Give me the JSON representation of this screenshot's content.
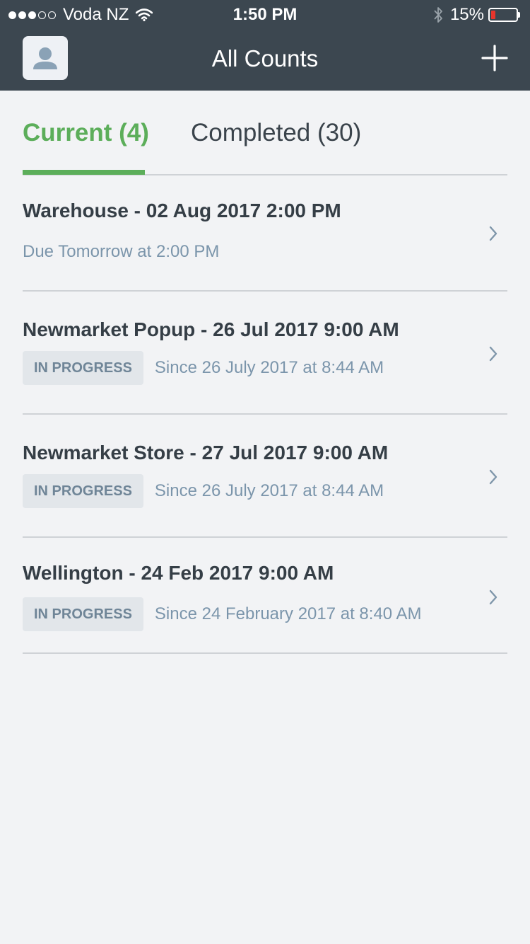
{
  "status_bar": {
    "carrier": "Voda NZ",
    "time": "1:50 PM",
    "battery_percent": "15%",
    "battery_level": 0.15,
    "signal_bars_filled": 3,
    "signal_bars_total": 5,
    "wifi_icon": "wifi-icon",
    "bluetooth_icon": "bluetooth-icon"
  },
  "header": {
    "title": "All Counts",
    "left_icon": "user-avatar-icon",
    "right_icon": "plus-icon"
  },
  "tabs": [
    {
      "label": "Current (4)",
      "active": true
    },
    {
      "label": "Completed (30)",
      "active": false
    }
  ],
  "counts": [
    {
      "title": "Warehouse - 02 Aug 2017 2:00 PM",
      "badge": "",
      "subtitle": "Due Tomorrow at 2:00 PM"
    },
    {
      "title": "Newmarket Popup - 26 Jul 2017 9:00 AM",
      "badge": "IN PROGRESS",
      "subtitle": "Since 26 July 2017 at 8:44 AM"
    },
    {
      "title": "Newmarket Store - 27 Jul 2017 9:00 AM",
      "badge": "IN PROGRESS",
      "subtitle": "Since 26 July 2017 at 8:44 AM"
    },
    {
      "title": "Wellington - 24 Feb 2017 9:00 AM",
      "badge": "IN PROGRESS",
      "subtitle": "Since 24 February 2017 at 8:40 AM"
    }
  ],
  "colors": {
    "header_bg": "#3c4750",
    "accent_green": "#5cae5a",
    "badge_bg": "#e2e6ea",
    "subtext": "#7b95ab"
  }
}
